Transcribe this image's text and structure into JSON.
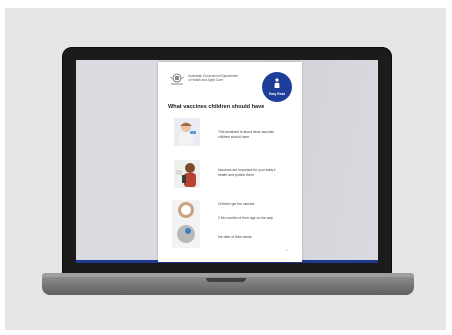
{
  "document": {
    "gov_text": "Australian Government Department of Health and Aged Care",
    "badge_label": "Easy Read",
    "title": "What vaccines children should have",
    "rows": [
      {
        "text": "This factsheet is about what vaccines children should have."
      },
      {
        "text": "Vaccines are important for your baby's health and protect them."
      },
      {
        "text": "Children get the vaccine"
      },
      {
        "text": "2 Mo months of their age on the way"
      },
      {
        "text": "the date of their needs"
      }
    ],
    "page_number": "1"
  },
  "colors": {
    "badge": "#1e3f99",
    "screen_accent": "#1f3b8f"
  },
  "icons": {
    "crest": "gov-crest-icon",
    "badge_figure": "person-icon"
  }
}
